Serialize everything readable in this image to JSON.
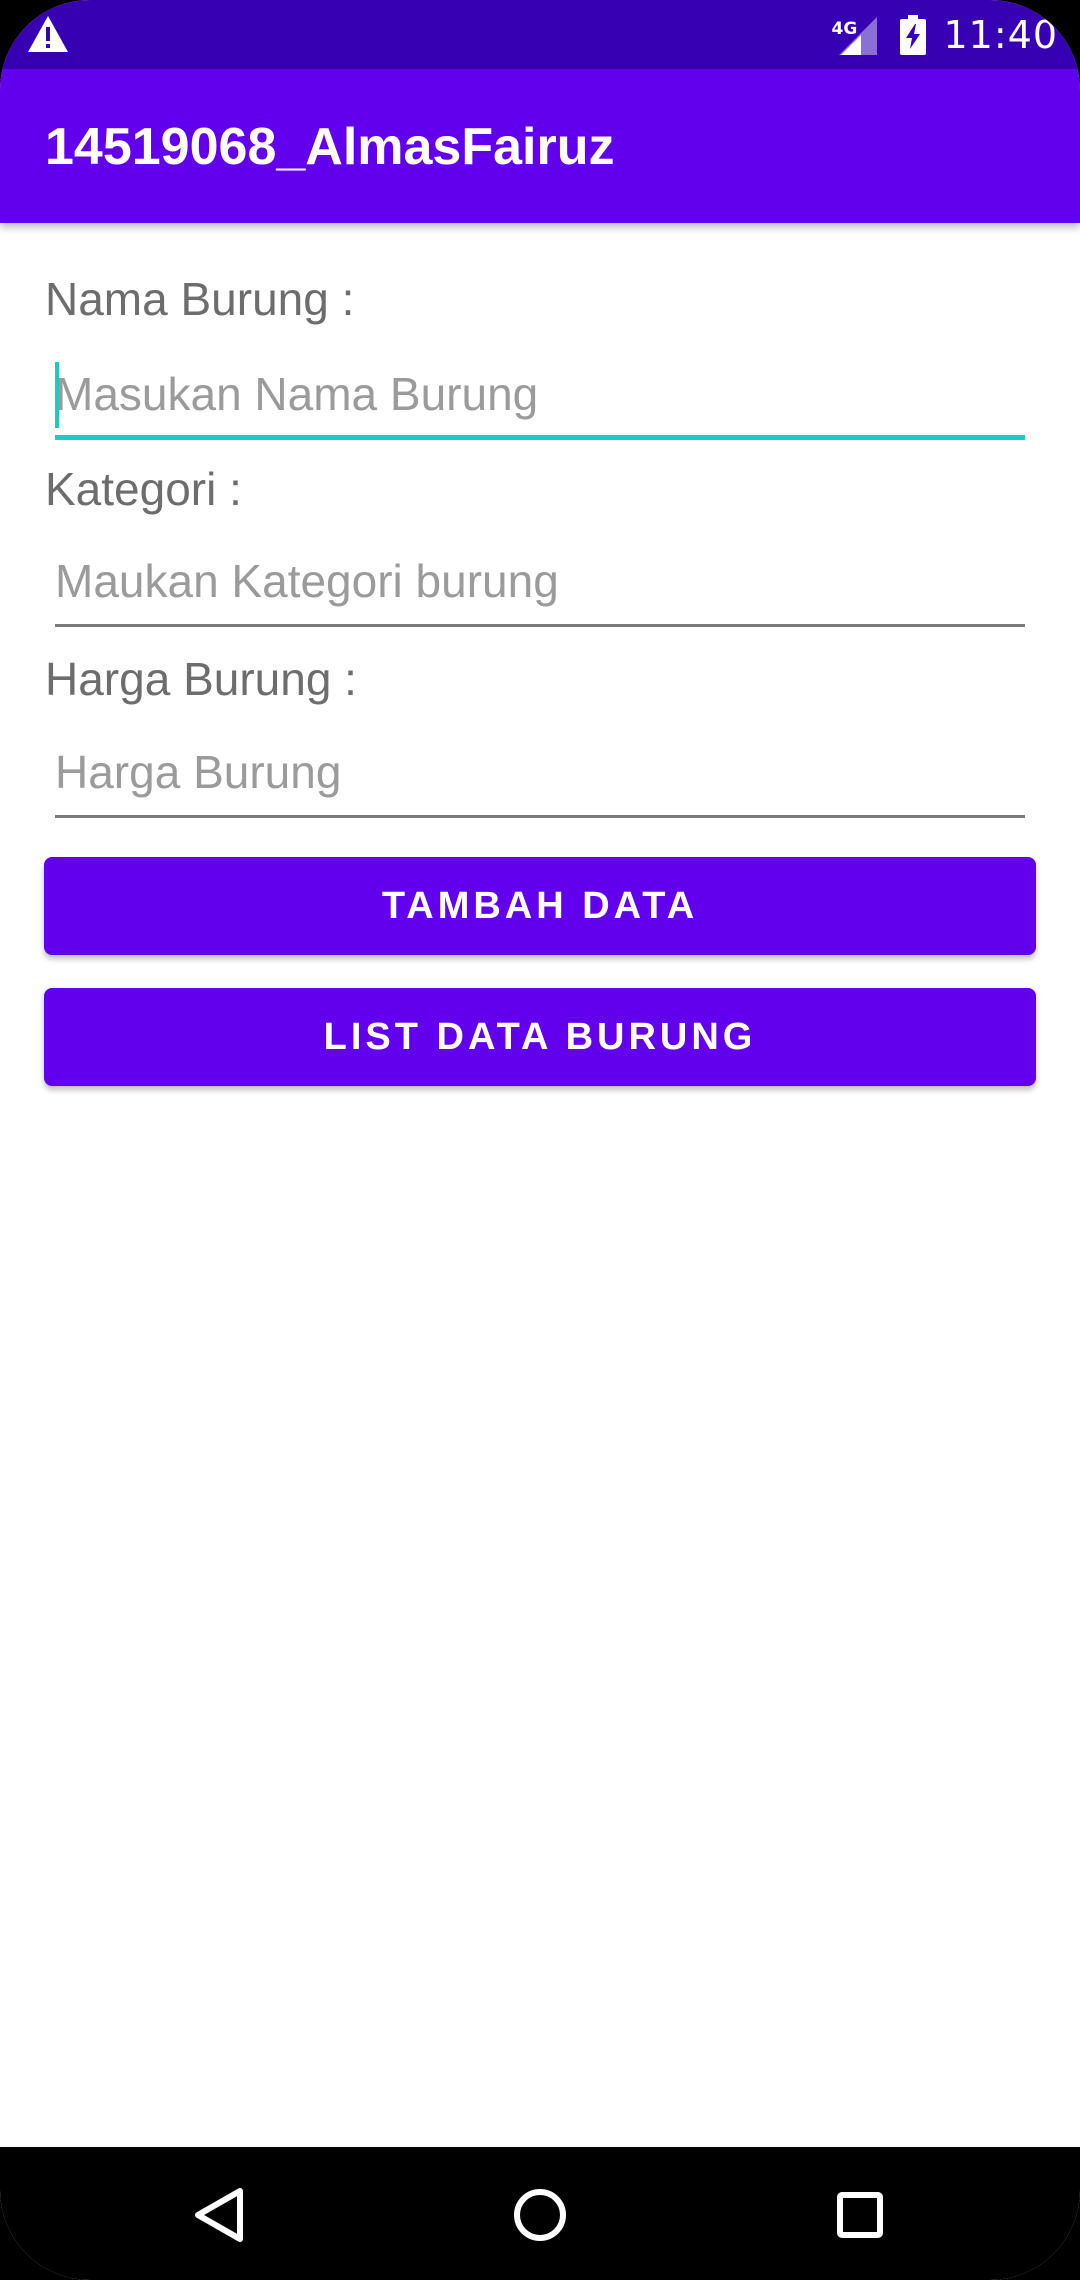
{
  "status_bar": {
    "network": "4G",
    "time": "11:40"
  },
  "app_bar": {
    "title": "14519068_AlmasFairuz"
  },
  "form": {
    "name_label": "Nama Burung :",
    "name_placeholder": "Masukan Nama Burung",
    "category_label": "Kategori :",
    "category_placeholder": "Maukan Kategori burung",
    "price_label": "Harga Burung :",
    "price_placeholder": "Harga Burung"
  },
  "buttons": {
    "add": "TAMBAH DATA",
    "list": "LIST DATA BURUNG"
  },
  "colors": {
    "primary": "#6200EE",
    "primary_dark": "#3700B3",
    "accent": "#1ECBC4"
  },
  "icons": {
    "status_left": "warning-icon",
    "signal": "signal-icon",
    "battery": "battery-charging-icon",
    "nav_back": "back-icon",
    "nav_home": "home-icon",
    "nav_recents": "recents-icon"
  }
}
